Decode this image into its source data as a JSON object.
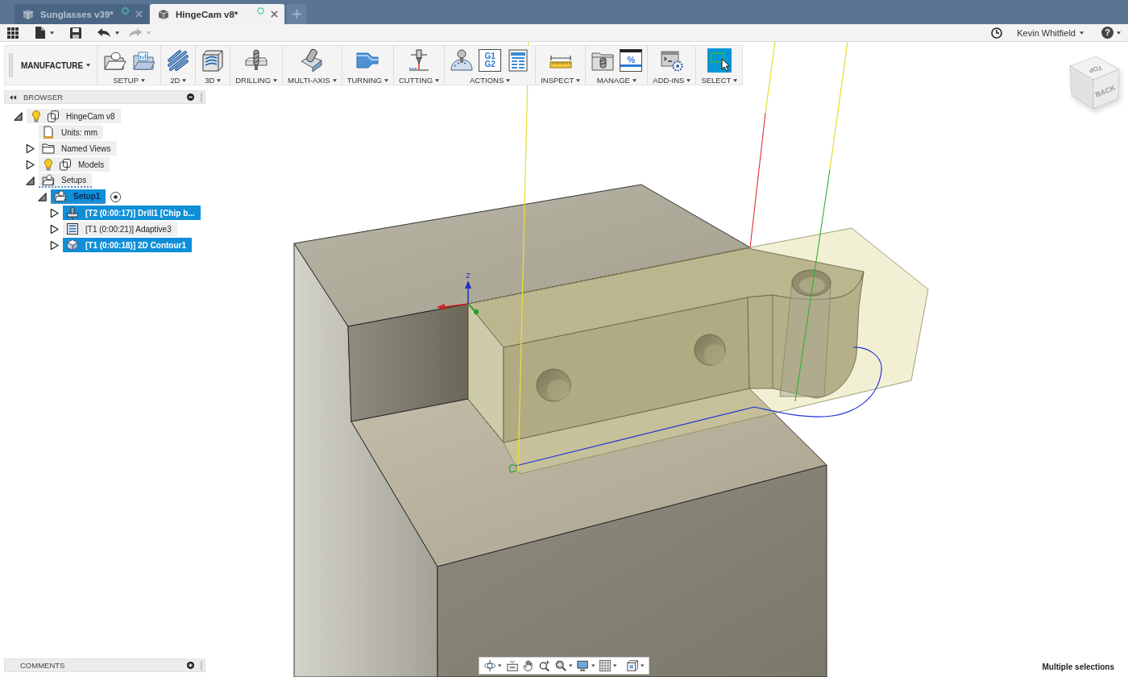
{
  "tabs": [
    {
      "label": "Sunglasses v39*",
      "selected": false
    },
    {
      "label": "HingeCam v8*",
      "selected": true
    }
  ],
  "quick_access": {
    "undo": {
      "disabled": false
    },
    "redo": {
      "disabled": true
    }
  },
  "user": {
    "name": "Kevin Whitfield"
  },
  "help": {
    "symbol": "?"
  },
  "toolbar": {
    "workspace": "MANUFACTURE",
    "groups": [
      {
        "label": "SETUP",
        "active": false
      },
      {
        "label": "2D",
        "active": false
      },
      {
        "label": "3D",
        "active": false
      },
      {
        "label": "DRILLING",
        "active": false
      },
      {
        "label": "MULTI-AXIS",
        "active": false
      },
      {
        "label": "TURNING",
        "active": false
      },
      {
        "label": "CUTTING",
        "active": false
      },
      {
        "label": "ACTIONS",
        "active": false,
        "icon_text": [
          "G1",
          "G2"
        ]
      },
      {
        "label": "INSPECT",
        "active": false
      },
      {
        "label": "MANAGE",
        "active": false,
        "icon_text": [
          "%"
        ]
      },
      {
        "label": "ADD-INS",
        "active": false
      },
      {
        "label": "SELECT",
        "active": true
      }
    ]
  },
  "browser": {
    "title": "BROWSER",
    "tree": [
      {
        "label": "HingeCam v8",
        "kind": "document",
        "expanded": true,
        "selected": false,
        "children": [
          {
            "label": "Units: mm",
            "kind": "units",
            "selected": false
          },
          {
            "label": "Named Views",
            "kind": "folder",
            "expanded": false,
            "selected": false
          },
          {
            "label": "Models",
            "kind": "models",
            "expanded": false,
            "selected": false
          },
          {
            "label": "Setups",
            "kind": "setups",
            "expanded": true,
            "selected": false,
            "children": [
              {
                "label": "Setup1",
                "kind": "setup",
                "expanded": true,
                "selected": true,
                "children": [
                  {
                    "label": "[T2 (0:00:17)] Drill1 [Chip b...",
                    "kind": "drilling",
                    "expanded": false,
                    "selected": true
                  },
                  {
                    "label": "[T1 (0:00:21)] Adaptive3",
                    "kind": "adaptive",
                    "expanded": false,
                    "selected": false
                  },
                  {
                    "label": "[T1 (0:00:18)] 2D Contour1",
                    "kind": "contour",
                    "expanded": false,
                    "selected": true
                  }
                ]
              }
            ]
          }
        ]
      }
    ]
  },
  "viewport": {
    "axis_label": "Z",
    "view_cube": {
      "top": "TOP",
      "back": "BACK"
    }
  },
  "comments": {
    "title": "COMMENTS"
  },
  "status_bar": {
    "selection": "Multiple selections"
  }
}
